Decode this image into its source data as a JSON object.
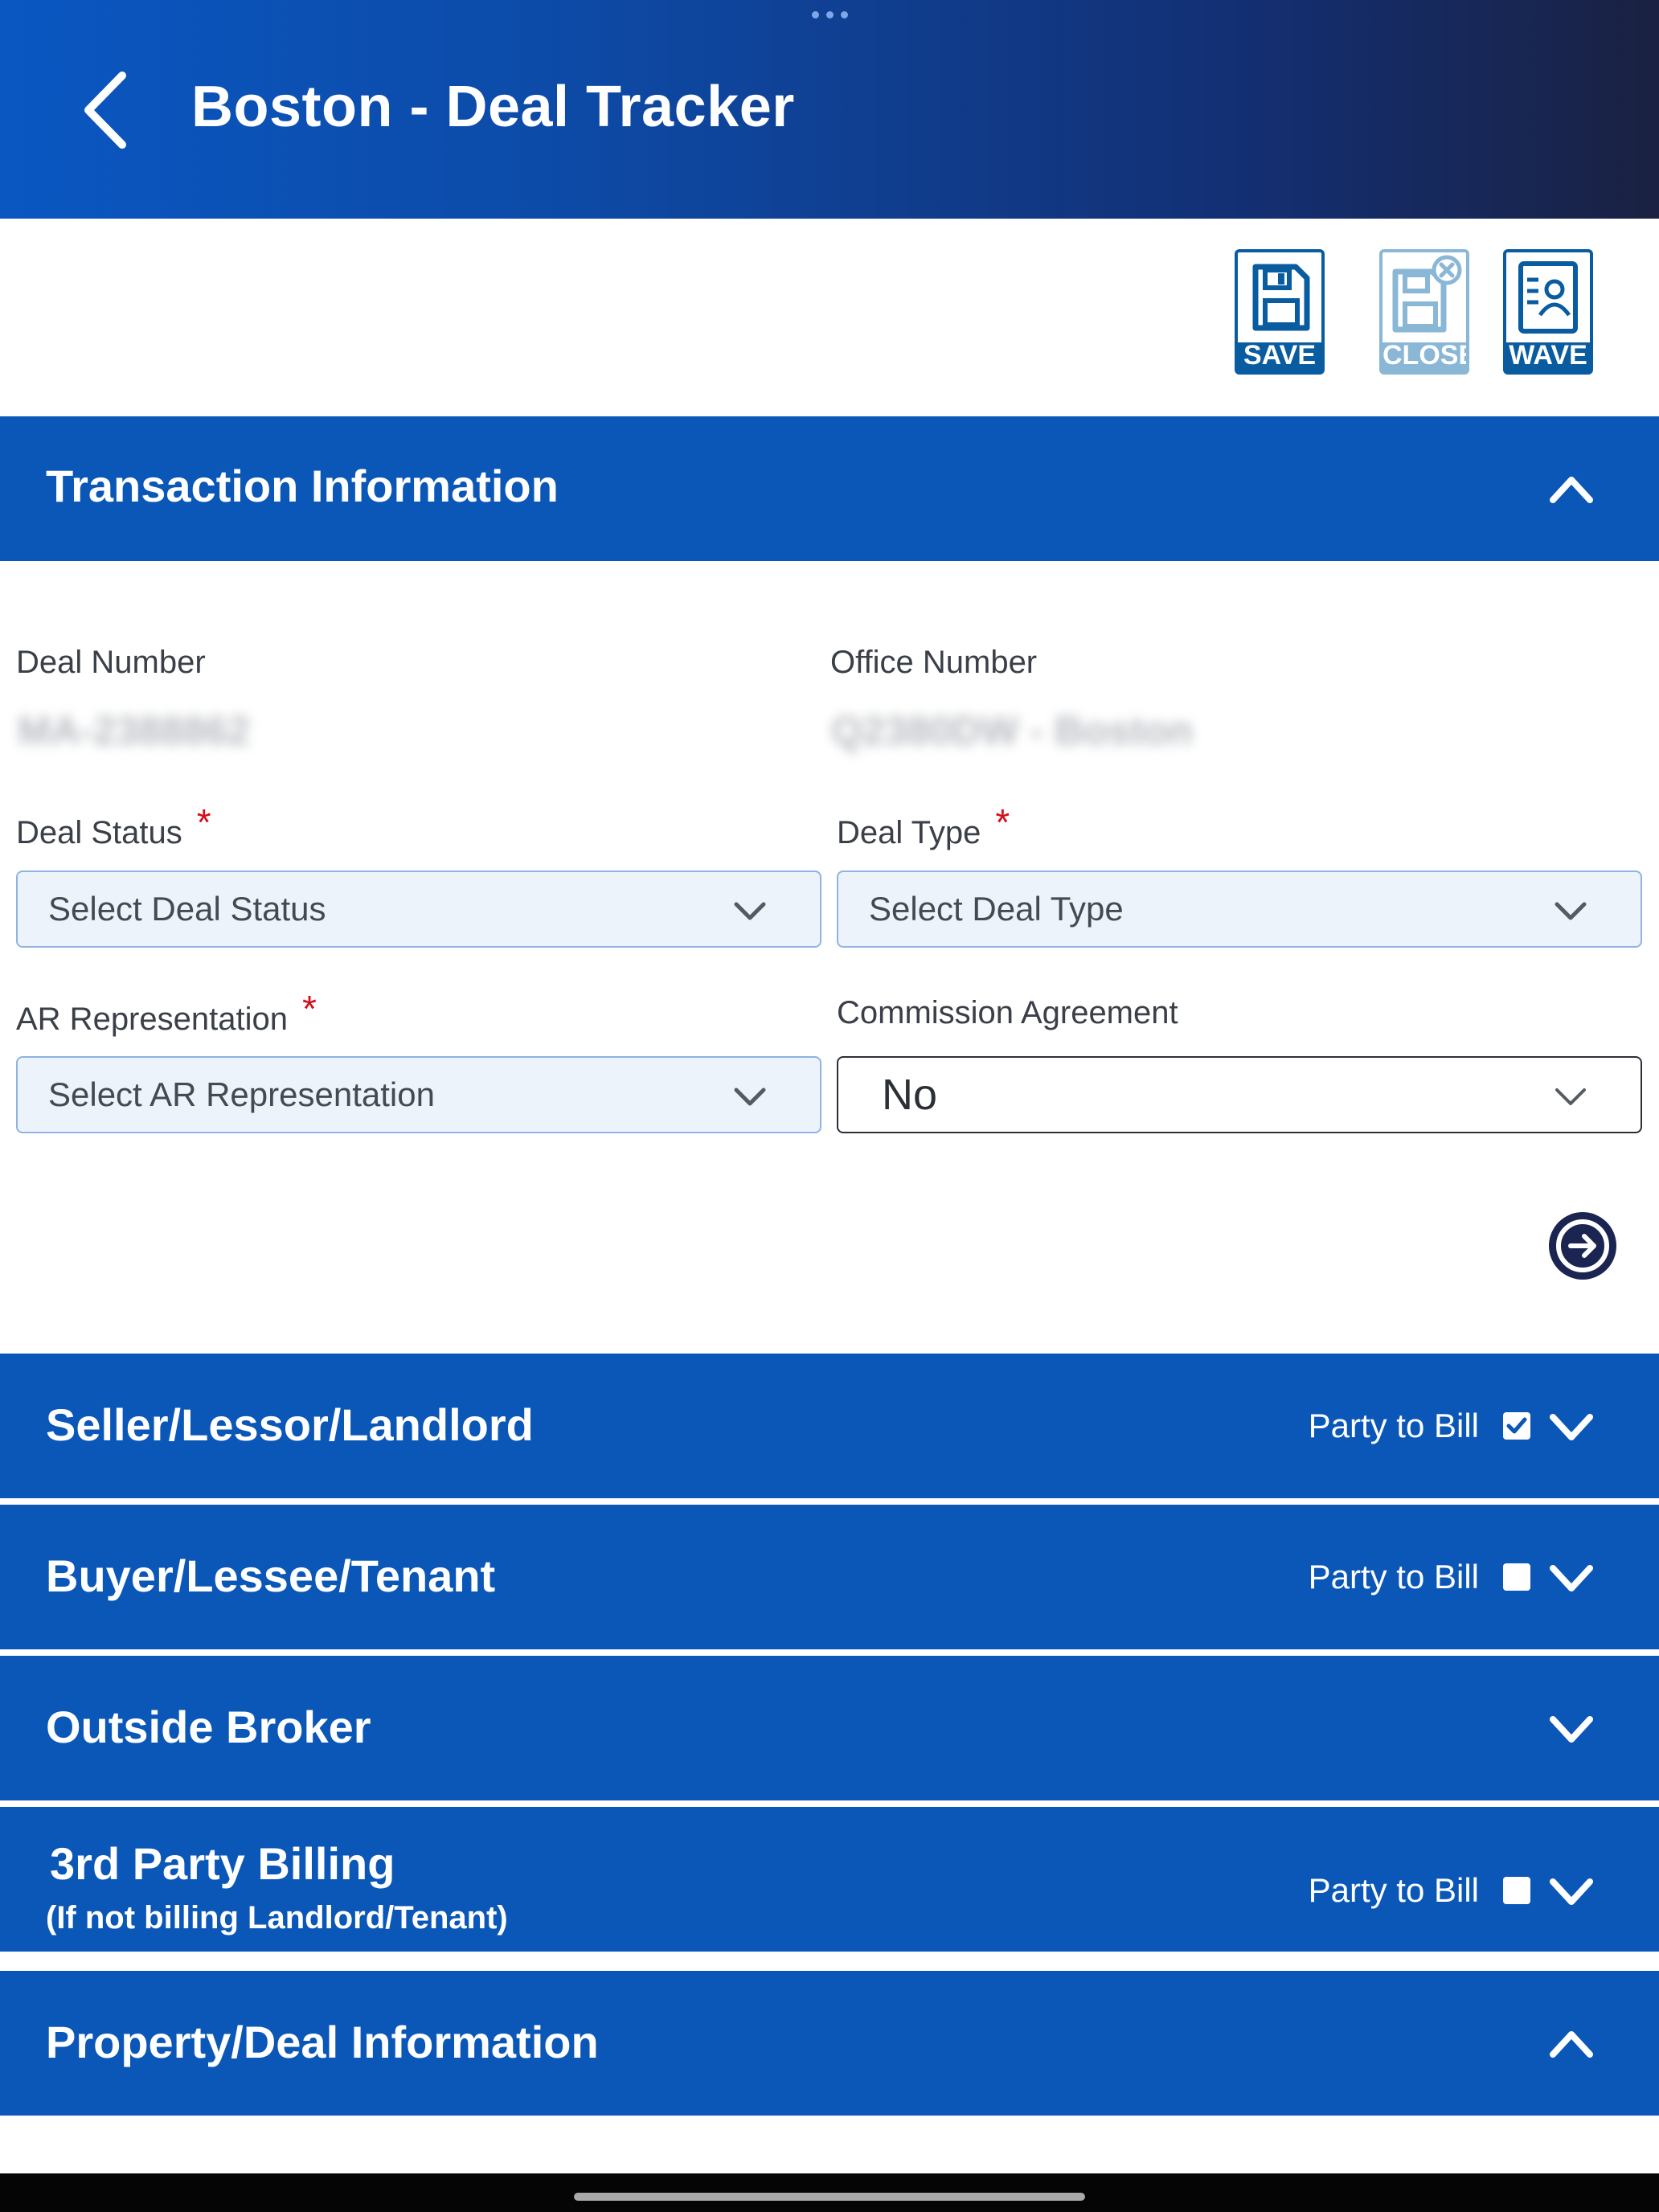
{
  "header": {
    "title": "Boston - Deal Tracker"
  },
  "toolbar": {
    "save_label": "SAVE",
    "close_label": "CLOSE",
    "wave_label": "WAVE"
  },
  "sections": {
    "transaction": {
      "title": "Transaction Information",
      "expanded": true
    },
    "seller": {
      "title": "Seller/Lessor/Landlord",
      "party_to_bill_label": "Party to Bill",
      "party_to_bill_checked": true
    },
    "buyer": {
      "title": "Buyer/Lessee/Tenant",
      "party_to_bill_label": "Party to Bill",
      "party_to_bill_checked": false
    },
    "outside_broker": {
      "title": "Outside Broker"
    },
    "third_party": {
      "title": "3rd Party Billing",
      "subtitle": "(If not billing Landlord/Tenant)",
      "party_to_bill_label": "Party to Bill",
      "party_to_bill_checked": false
    },
    "property": {
      "title": "Property/Deal Information",
      "expanded": true
    }
  },
  "form": {
    "deal_number": {
      "label": "Deal Number",
      "value": "MA-2388862"
    },
    "office_number": {
      "label": "Office Number",
      "value": "Q2380DW - Boston"
    },
    "deal_status": {
      "label": "Deal Status",
      "required_mark": "*",
      "placeholder": "Select Deal Status"
    },
    "deal_type": {
      "label": "Deal Type",
      "required_mark": "*",
      "placeholder": "Select Deal Type"
    },
    "ar_representation": {
      "label": "AR Representation",
      "required_mark": "*",
      "placeholder": "Select AR Representation"
    },
    "commission_agreement": {
      "label": "Commission Agreement",
      "value": "No"
    }
  },
  "colors": {
    "section_bar": "#0a57b8",
    "header_start": "#0a57c2",
    "header_end": "#1a2142",
    "required": "#d40f1c",
    "select_bg": "#edf3fb"
  }
}
